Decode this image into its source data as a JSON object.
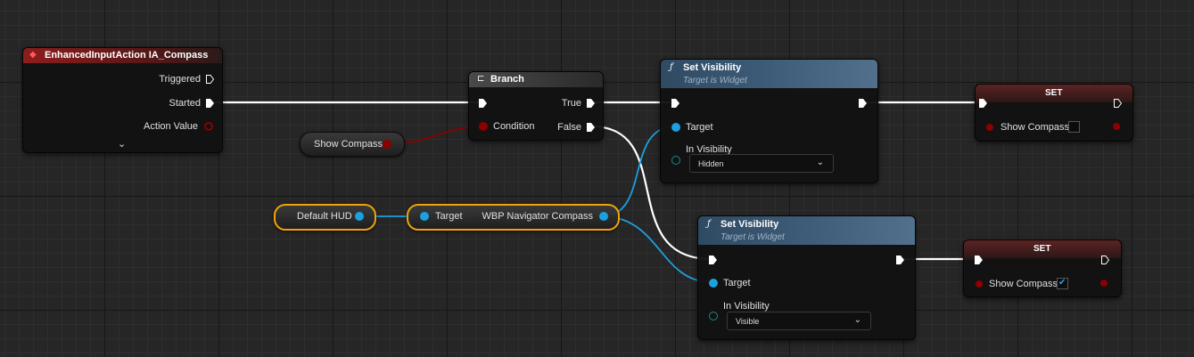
{
  "colors": {
    "exec": "#ffffff",
    "object": "#1ba0e0",
    "bool": "#8c0000",
    "selection": "#f2a20c"
  },
  "nodes": {
    "input": {
      "title": "EnhancedInputAction IA_Compass",
      "pins": {
        "triggered": "Triggered",
        "started": "Started",
        "action_value": "Action Value"
      },
      "expand_icon": "chevron-down-icon"
    },
    "branch": {
      "title": "Branch",
      "pins": {
        "condition": "Condition",
        "true": "True",
        "false": "False"
      }
    },
    "show_compass_get": {
      "label": "Show Compass"
    },
    "default_hud": {
      "label": "Default HUD"
    },
    "nav_compass": {
      "target": "Target",
      "output": "WBP Navigator Compass"
    },
    "set_vis_1": {
      "title": "Set Visibility",
      "subtitle": "Target is Widget",
      "target": "Target",
      "in_visibility": "In Visibility",
      "value": "Hidden"
    },
    "set_vis_2": {
      "title": "Set Visibility",
      "subtitle": "Target is Widget",
      "target": "Target",
      "in_visibility": "In Visibility",
      "value": "Visible"
    },
    "set_1": {
      "title": "SET",
      "var": "Show Compass",
      "checked": false
    },
    "set_2": {
      "title": "SET",
      "var": "Show Compass",
      "checked": true
    }
  }
}
